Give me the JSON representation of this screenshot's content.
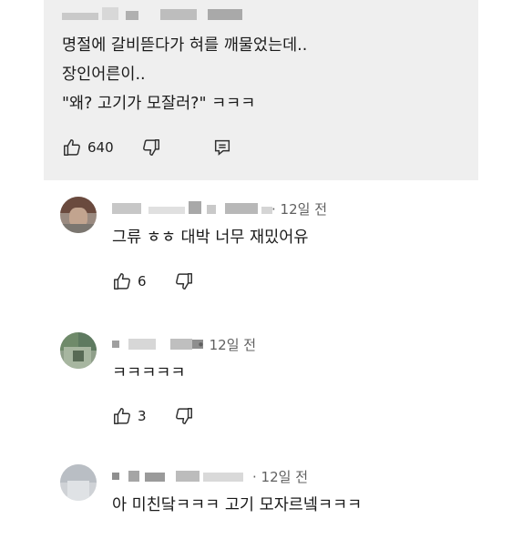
{
  "top_comment": {
    "line1": "명절에 갈비뜯다가 혀를 깨물었는데..",
    "line2": "장인어른이..",
    "line3": "\"왜? 고기가 모잘러?\" ㅋㅋㅋ",
    "likes": "640"
  },
  "replies": [
    {
      "time": "· 12일 전",
      "text": "그류  ㅎㅎ 대박 너무 재밌어유",
      "likes": "6"
    },
    {
      "time": "• 12일 전",
      "text": "ㅋㅋㅋㅋㅋ",
      "likes": "3"
    },
    {
      "time": "· 12일 전",
      "text": "아 미친닼ㅋㅋㅋ 고기 모자르넼ㅋㅋㅋ"
    }
  ],
  "icons": [
    "like-icon",
    "dislike-icon",
    "reply-icon"
  ],
  "colors": {
    "highlight_bg": "#efefef",
    "meta_gray": "#606060"
  }
}
